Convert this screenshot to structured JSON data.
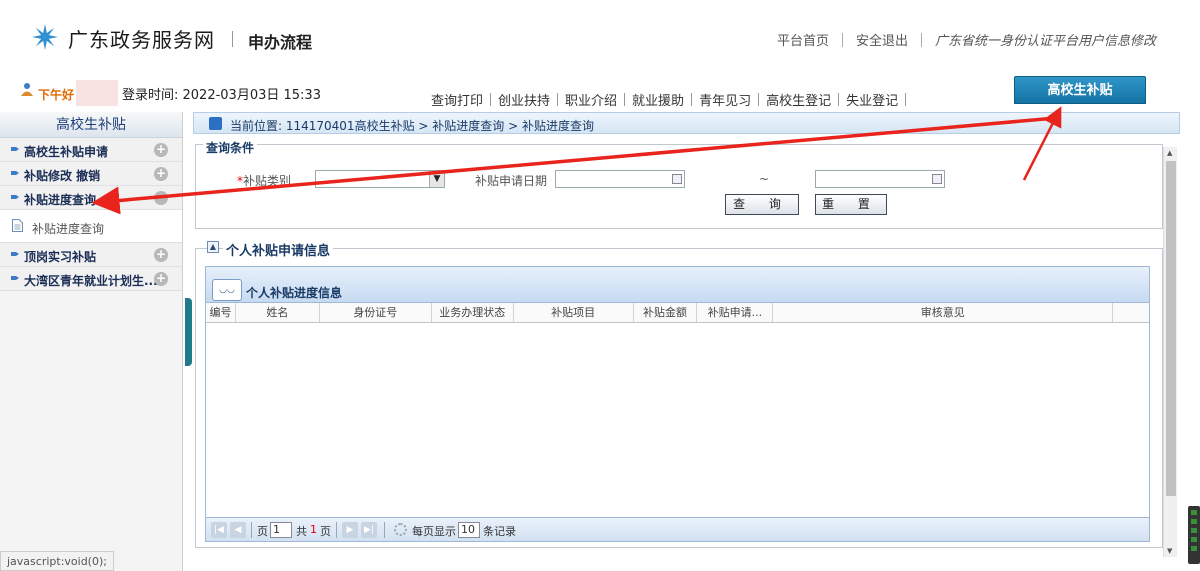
{
  "header": {
    "site_name": "广东政务服务网",
    "page_title": "申办流程",
    "links": [
      "平台首页",
      "安全退出",
      "广东省统一身份认证平台用户信息修改"
    ]
  },
  "navbar": {
    "greeting": "下午好",
    "login_time": "登录时间: 2022-03月03日 15:33",
    "tabs": [
      "查询打印",
      "创业扶持",
      "职业介绍",
      "就业援助",
      "青年见习",
      "高校生登记",
      "失业登记"
    ],
    "active_tab": "高校生补贴"
  },
  "sidebar": {
    "title": "高校生补贴",
    "items": [
      {
        "label": "高校生补贴申请",
        "toggle": "+"
      },
      {
        "label": "补贴修改 撤销",
        "toggle": "+"
      },
      {
        "label": "补贴进度查询",
        "toggle": "−"
      },
      {
        "label": "补贴进度查询",
        "sub": true
      },
      {
        "label": "顶岗实习补贴",
        "toggle": "+"
      },
      {
        "label": "大湾区青年就业计划生...",
        "toggle": "+"
      }
    ]
  },
  "breadcrumb": "当前位置: 114170401高校生补贴 > 补贴进度查询 > 补贴进度查询",
  "query": {
    "legend": "查询条件",
    "type_label": "补贴类别",
    "type_required": "*",
    "type_value": "",
    "date_label": "补贴申请日期",
    "date_sep": "~",
    "date_from": "",
    "date_to": "",
    "search_button": "查 询",
    "reset_button": "重 置"
  },
  "info": {
    "legend": "个人补贴申请信息",
    "grid_title": "个人补贴进度信息",
    "columns": [
      "编号",
      "姓名",
      "身份证号",
      "业务办理状态",
      "补贴项目",
      "补贴金额",
      "补贴申请...",
      "审核意见"
    ],
    "rows": []
  },
  "pager": {
    "page_prefix": "页",
    "current_page": "1",
    "total_prefix": "共",
    "total_pages": "1",
    "total_suffix": "页",
    "per_page_label": "每页显示",
    "per_page": "10",
    "records_label": "条记录"
  },
  "status_bar": "javascript:void(0);",
  "colors": {
    "accent": "#1673a5",
    "annotation_arrow": "#e8241c",
    "sidebar_text": "#1a2d55",
    "greeting": "#e06a00"
  }
}
